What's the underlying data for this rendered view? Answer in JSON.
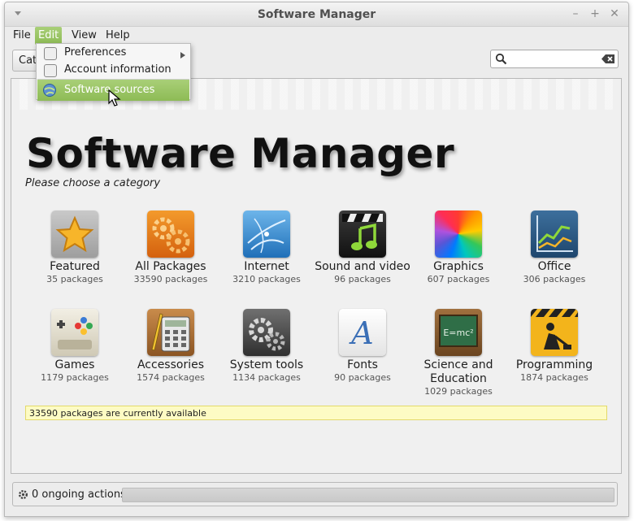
{
  "window": {
    "title": "Software Manager"
  },
  "menubar": {
    "items": [
      "File",
      "Edit",
      "View",
      "Help"
    ]
  },
  "toolbar": {
    "categories_label": "Categories"
  },
  "search": {
    "placeholder": "",
    "value": ""
  },
  "edit_menu": {
    "items": [
      {
        "label": "Preferences",
        "has_submenu": true,
        "icon": "preferences-icon"
      },
      {
        "label": "Account information",
        "has_submenu": false,
        "icon": "account-icon"
      },
      {
        "label": "Software sources",
        "has_submenu": false,
        "icon": "software-sources-icon",
        "highlighted": true
      }
    ]
  },
  "main": {
    "heading": "Software Manager",
    "subtitle": "Please choose a category",
    "categories": [
      {
        "name": "Featured",
        "count": "35 packages",
        "icon": "star-icon"
      },
      {
        "name": "All Packages",
        "count": "33590 packages",
        "icon": "gears-icon"
      },
      {
        "name": "Internet",
        "count": "3210 packages",
        "icon": "globe-icon"
      },
      {
        "name": "Sound and video",
        "count": "96 packages",
        "icon": "music-clapper-icon"
      },
      {
        "name": "Graphics",
        "count": "607 packages",
        "icon": "color-wheel-icon"
      },
      {
        "name": "Office",
        "count": "306 packages",
        "icon": "chart-icon"
      },
      {
        "name": "Games",
        "count": "1179 packages",
        "icon": "gamepad-icon"
      },
      {
        "name": "Accessories",
        "count": "1574 packages",
        "icon": "calculator-icon"
      },
      {
        "name": "System tools",
        "count": "1134 packages",
        "icon": "system-gears-icon"
      },
      {
        "name": "Fonts",
        "count": "90 packages",
        "icon": "font-icon"
      },
      {
        "name": "Science and Education",
        "count": "1029 packages",
        "icon": "chalkboard-icon"
      },
      {
        "name": "Programming",
        "count": "1874 packages",
        "icon": "construction-icon"
      }
    ],
    "status": "33590 packages are currently available"
  },
  "bottom": {
    "actions_label": "0 ongoing actions"
  },
  "colors": {
    "accent": "#8dbb55",
    "status_bg": "#fdfbc4"
  }
}
